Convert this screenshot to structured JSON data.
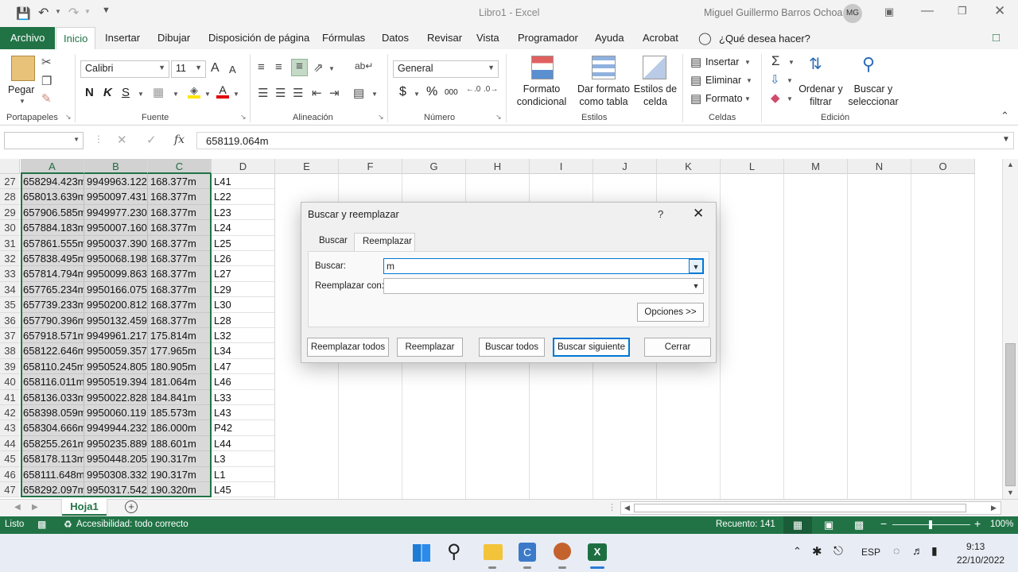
{
  "window": {
    "title": "Libro1  -  Excel",
    "user": "Miguel Guillermo Barros Ochoa",
    "initials": "MG"
  },
  "tabs": [
    "Archivo",
    "Inicio",
    "Insertar",
    "Dibujar",
    "Disposición de página",
    "Fórmulas",
    "Datos",
    "Revisar",
    "Vista",
    "Programador",
    "Ayuda",
    "Acrobat"
  ],
  "tell_me": "¿Qué desea hacer?",
  "ribbon": {
    "portapapeles": {
      "paste": "Pegar",
      "group": "Portapapeles"
    },
    "fuente": {
      "font": "Calibri",
      "size": "11",
      "bold": "N",
      "italic": "K",
      "underline": "S",
      "grow": "A",
      "shrink": "A",
      "color_a": "A",
      "group": "Fuente"
    },
    "alineacion": {
      "group": "Alineación"
    },
    "numero": {
      "format": "General",
      "currency": "$",
      "percent": "%",
      "thousands": "000",
      "group": "Número"
    },
    "estilos": {
      "cond1": "Formato",
      "cond2": "condicional",
      "table1": "Dar formato",
      "table2": "como tabla",
      "cell1": "Estilos de",
      "cell2": "celda",
      "group": "Estilos"
    },
    "celdas": {
      "insert": "Insertar",
      "delete": "Eliminar",
      "format": "Formato",
      "group": "Celdas"
    },
    "edicion": {
      "sort1": "Ordenar y",
      "sort2": "filtrar",
      "find1": "Buscar y",
      "find2": "seleccionar",
      "group": "Edición"
    }
  },
  "formula_bar": {
    "name_box": "",
    "fx": "fx",
    "value": "658119.064m"
  },
  "columns": [
    "A",
    "B",
    "C",
    "D",
    "E",
    "F",
    "G",
    "H",
    "I",
    "J",
    "K",
    "L",
    "M",
    "N",
    "O"
  ],
  "rows": [
    {
      "n": "27",
      "a": "658294.423m",
      "b": "9949963.122",
      "c": "168.377m",
      "d": "L41"
    },
    {
      "n": "28",
      "a": "658013.639m",
      "b": "9950097.431",
      "c": "168.377m",
      "d": "L22"
    },
    {
      "n": "29",
      "a": "657906.585m",
      "b": "9949977.230",
      "c": "168.377m",
      "d": "L23"
    },
    {
      "n": "30",
      "a": "657884.183m",
      "b": "9950007.160",
      "c": "168.377m",
      "d": "L24"
    },
    {
      "n": "31",
      "a": "657861.555m",
      "b": "9950037.390",
      "c": "168.377m",
      "d": "L25"
    },
    {
      "n": "32",
      "a": "657838.495m",
      "b": "9950068.198",
      "c": "168.377m",
      "d": "L26"
    },
    {
      "n": "33",
      "a": "657814.794m",
      "b": "9950099.863",
      "c": "168.377m",
      "d": "L27"
    },
    {
      "n": "34",
      "a": "657765.234m",
      "b": "9950166.075",
      "c": "168.377m",
      "d": "L29"
    },
    {
      "n": "35",
      "a": "657739.233m",
      "b": "9950200.812",
      "c": "168.377m",
      "d": "L30"
    },
    {
      "n": "36",
      "a": "657790.396m",
      "b": "9950132.459",
      "c": "168.377m",
      "d": "L28"
    },
    {
      "n": "37",
      "a": "657918.571m",
      "b": "9949961.217",
      "c": "175.814m",
      "d": "L32"
    },
    {
      "n": "38",
      "a": "658122.646m",
      "b": "9950059.357",
      "c": "177.965m",
      "d": "L34"
    },
    {
      "n": "39",
      "a": "658110.245m",
      "b": "9950524.805",
      "c": "180.905m",
      "d": "L47"
    },
    {
      "n": "40",
      "a": "658116.011m",
      "b": "9950519.394",
      "c": "181.064m",
      "d": "L46"
    },
    {
      "n": "41",
      "a": "658136.033m",
      "b": "9950022.828",
      "c": "184.841m",
      "d": "L33"
    },
    {
      "n": "42",
      "a": "658398.059m",
      "b": "9950060.119",
      "c": "185.573m",
      "d": "L43"
    },
    {
      "n": "43",
      "a": "658304.666m",
      "b": "9949944.232",
      "c": "186.000m",
      "d": "P42"
    },
    {
      "n": "44",
      "a": "658255.261m",
      "b": "9950235.889",
      "c": "188.601m",
      "d": "L44"
    },
    {
      "n": "45",
      "a": "658178.113m",
      "b": "9950448.205",
      "c": "190.317m",
      "d": "L3"
    },
    {
      "n": "46",
      "a": "658111.648m",
      "b": "9950308.332",
      "c": "190.317m",
      "d": "L1"
    },
    {
      "n": "47",
      "a": "658292.097m",
      "b": "9950317.542",
      "c": "190.320m",
      "d": "L45"
    }
  ],
  "sheet": {
    "name": "Hoja1"
  },
  "status": {
    "ready": "Listo",
    "accessibility": "Accesibilidad: todo correcto",
    "count": "Recuento: 141",
    "zoom": "100%"
  },
  "dialog": {
    "title": "Buscar y reemplazar",
    "help": "?",
    "tab_find": "Buscar",
    "tab_replace": "Reemplazar",
    "find_label": "Buscar:",
    "find_value": "m",
    "replace_label": "Reemplazar con:",
    "replace_value": "",
    "options": "Opciones >>",
    "replace_all": "Reemplazar todos",
    "replace": "Reemplazar",
    "find_all": "Buscar todos",
    "find_next": "Buscar siguiente",
    "close": "Cerrar"
  },
  "taskbar": {
    "lang": "ESP",
    "time": "9:13",
    "date": "22/10/2022"
  },
  "colors": {
    "accent": "#217346",
    "selection": "#d9d9d9"
  }
}
